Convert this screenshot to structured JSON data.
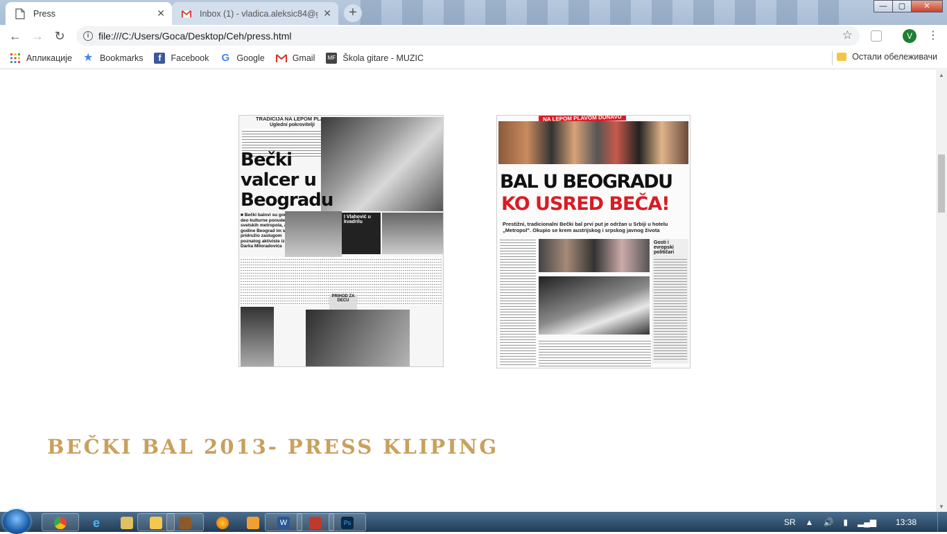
{
  "browser": {
    "tabs": [
      {
        "title": "Press",
        "active": true
      },
      {
        "title": "Inbox (1) - vladica.aleksic84@gm",
        "active": false
      }
    ],
    "new_tab_label": "+",
    "url": "file:///C:/Users/Goca/Desktop/Ceh/press.html",
    "profile_initial": "V",
    "window_controls": {
      "minimize": "—",
      "maximize": "▢",
      "close": "✕"
    }
  },
  "bookmarks": {
    "items": [
      {
        "label": "Апликације",
        "icon": "apps-grid-icon"
      },
      {
        "label": "Bookmarks",
        "icon": "star-icon"
      },
      {
        "label": "Facebook",
        "icon": "facebook-icon"
      },
      {
        "label": "Google",
        "icon": "google-icon"
      },
      {
        "label": "Gmail",
        "icon": "gmail-icon"
      },
      {
        "label": "Škola gitare - MUZIC",
        "icon": "mf-icon"
      }
    ],
    "other": "Остали обележивачи"
  },
  "page": {
    "clip1": {
      "kicker": "TRADICIJA NA LEPOM PLAVOM DUNAVU",
      "subkicker": "Uglední pokrovitelji",
      "headline": [
        "Bečki",
        "valcer u",
        "Beogradu"
      ],
      "lead": "■ Bečki balovi su godinama deo kulturne ponude velikih svetskih metropola, a ove godine Beograd im se pridružio zaslugom poznatog aktiviste iz Beča Darka Miloradovića",
      "box_title": "I Vlahović u kvadrilu",
      "box2_title": "PRIHOD ZA DECU"
    },
    "clip2": {
      "banner": "NA LEPOM PLAVOM DUNAVU",
      "headline_top": "BAL U BEOGRADU",
      "headline_bottom": "KO USRED BEČA!",
      "deck": "Prestižni, tradicionalni Bečki bal prvi put je održan u Srbiji u hotelu „Metropol\". Okupio se krem austrijskog i srpskog javnog života",
      "sidebar_title": "Gosti i evropski političari"
    },
    "section_title": "BEČKI BAL 2013- PRESS KLIPING"
  },
  "taskbar": {
    "language": "SR",
    "time": "13:38"
  },
  "colors": {
    "title_gold": "#c9a05e",
    "headline_red": "#d91c24",
    "taskbar": "#2f4d6b"
  }
}
